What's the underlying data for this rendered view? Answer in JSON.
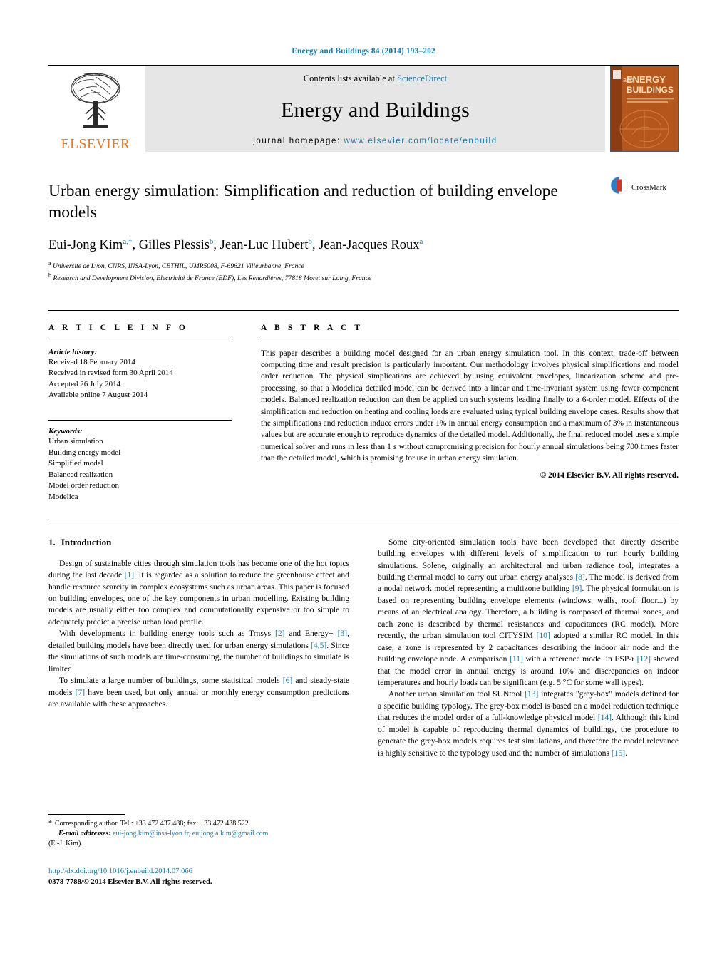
{
  "running_head": "Energy and Buildings 84 (2014) 193–202",
  "masthead": {
    "contents_prefix": "Contents lists available at ",
    "contents_link": "ScienceDirect",
    "journal_name": "Energy and Buildings",
    "homepage_prefix": "journal homepage: ",
    "homepage_url": "www.elsevier.com/locate/enbuild",
    "publisher": "ELSEVIER",
    "cover_title_small": "and",
    "cover_title_main": "ENERGY",
    "cover_title_main2": "BUILDINGS"
  },
  "article": {
    "title": "Urban energy simulation: Simplification and reduction of building envelope models",
    "authors_html": "Eui-Jong Kim, Gilles Plessis, Jean-Luc Hubert, Jean-Jacques Roux",
    "author_list": [
      {
        "name": "Eui-Jong Kim",
        "marks": "a,*"
      },
      {
        "name": "Gilles Plessis",
        "marks": "b"
      },
      {
        "name": "Jean-Luc Hubert",
        "marks": "b"
      },
      {
        "name": "Jean-Jacques Roux",
        "marks": "a"
      }
    ],
    "affiliations": [
      {
        "mark": "a",
        "text": "Université de Lyon, CNRS, INSA-Lyon, CETHIL, UMR5008, F-69621 Villeurbanne, France"
      },
      {
        "mark": "b",
        "text": "Research and Development Division, Electricité de France (EDF), Les Renardières, 77818 Moret sur Loing, France"
      }
    ],
    "crossmark_label": "CrossMark"
  },
  "article_info": {
    "heading": "A R T I C L E   I N F O",
    "history_label": "Article history:",
    "history": [
      "Received 18 February 2014",
      "Received in revised form 30 April 2014",
      "Accepted 26 July 2014",
      "Available online 7 August 2014"
    ],
    "keywords_label": "Keywords:",
    "keywords": [
      "Urban simulation",
      "Building energy model",
      "Simplified model",
      "Balanced realization",
      "Model order reduction",
      "Modelica"
    ]
  },
  "abstract": {
    "heading": "A B S T R A C T",
    "text": "This paper describes a building model designed for an urban energy simulation tool. In this context, trade-off between computing time and result precision is particularly important. Our methodology involves physical simplifications and model order reduction. The physical simplications are achieved by using equivalent envelopes, linearization scheme and pre-processing, so that a Modelica detailed model can be derived into a linear and time-invariant system using fewer component models. Balanced realization reduction can then be applied on such systems leading finally to a 6-order model. Effects of the simplification and reduction on heating and cooling loads are evaluated using typical building envelope cases. Results show that the simplifications and reduction induce errors under 1% in annual energy consumption and a maximum of 3% in instantaneous values but are accurate enough to reproduce dynamics of the detailed model. Additionally, the final reduced model uses a simple numerical solver and runs in less than 1 s without compromising precision for hourly annual simulations being 700 times faster than the detailed model, which is promising for use in urban energy simulation.",
    "copyright": "© 2014 Elsevier B.V. All rights reserved."
  },
  "introduction": {
    "number": "1.",
    "heading": "Introduction",
    "left_paragraphs": [
      {
        "parts": [
          {
            "t": "Design of sustainable cities through simulation tools has become one of the hot topics during the last decade ",
            "k": "text"
          },
          {
            "t": "[1]",
            "k": "cite"
          },
          {
            "t": ". It is regarded as a solution to reduce the greenhouse effect and handle resource scarcity in complex ecosystems such as urban areas. This paper is focused on building envelopes, one of the key components in urban modelling. Existing building models are usually either too complex and computationally expensive or too simple to adequately predict a precise urban load profile.",
            "k": "text"
          }
        ]
      },
      {
        "parts": [
          {
            "t": "With developments in building energy tools such as Trnsys ",
            "k": "text"
          },
          {
            "t": "[2]",
            "k": "cite"
          },
          {
            "t": " and Energy+ ",
            "k": "text"
          },
          {
            "t": "[3]",
            "k": "cite"
          },
          {
            "t": ", detailed building models have been directly used for urban energy simulations ",
            "k": "text"
          },
          {
            "t": "[4,5]",
            "k": "cite"
          },
          {
            "t": ". Since the simulations of such models are time-consuming, the number of buildings to simulate is limited.",
            "k": "text"
          }
        ]
      },
      {
        "parts": [
          {
            "t": "To simulate a large number of buildings, some statistical models ",
            "k": "text"
          },
          {
            "t": "[6]",
            "k": "cite"
          },
          {
            "t": " and steady-state models ",
            "k": "text"
          },
          {
            "t": "[7]",
            "k": "cite"
          },
          {
            "t": " have been used, but only annual or monthly energy consumption predictions are available with these approaches.",
            "k": "text"
          }
        ]
      }
    ],
    "right_paragraphs": [
      {
        "parts": [
          {
            "t": "Some city-oriented simulation tools have been developed that directly describe building envelopes with different levels of simplification to run hourly building simulations. Solene, originally an architectural and urban radiance tool, integrates a building thermal model to carry out urban energy analyses ",
            "k": "text"
          },
          {
            "t": "[8]",
            "k": "cite"
          },
          {
            "t": ". The model is derived from a nodal network model representing a multizone building ",
            "k": "text"
          },
          {
            "t": "[9]",
            "k": "cite"
          },
          {
            "t": ". The physical formulation is based on representing building envelope elements (windows, walls, roof, floor...) by means of an electrical analogy. Therefore, a building is composed of thermal zones, and each zone is described by thermal resistances and capacitances (RC model). More recently, the urban simulation tool CITYSIM ",
            "k": "text"
          },
          {
            "t": "[10]",
            "k": "cite"
          },
          {
            "t": " adopted a similar RC model. In this case, a zone is represented by 2 capacitances describing the indoor air node and the building envelope node. A comparison ",
            "k": "text"
          },
          {
            "t": "[11]",
            "k": "cite"
          },
          {
            "t": " with a reference model in ESP-r ",
            "k": "text"
          },
          {
            "t": "[12]",
            "k": "cite"
          },
          {
            "t": " showed that the model error in annual energy is around 10% and discrepancies on indoor temperatures and hourly loads can be significant (e.g. 5 °C for some wall types).",
            "k": "text"
          }
        ]
      },
      {
        "parts": [
          {
            "t": "Another urban simulation tool SUNtool ",
            "k": "text"
          },
          {
            "t": "[13]",
            "k": "cite"
          },
          {
            "t": " integrates \"grey-box\" models defined for a specific building typology. The grey-box model is based on a model reduction technique that reduces the model order of a full-knowledge physical model ",
            "k": "text"
          },
          {
            "t": "[14]",
            "k": "cite"
          },
          {
            "t": ". Although this kind of model is capable of reproducing thermal dynamics of buildings, the procedure to generate the grey-box models requires test simulations, and therefore the model relevance is highly sensitive to the typology used and the number of simulations ",
            "k": "text"
          },
          {
            "t": "[15]",
            "k": "cite"
          },
          {
            "t": ".",
            "k": "text"
          }
        ]
      }
    ]
  },
  "footnotes": {
    "corresponding_star": "*",
    "corresponding": "Corresponding author. Tel.: +33 472 437 488; fax: +33 472 438 522.",
    "email_label": "E-mail addresses:",
    "email_1": "eui-jong.kim@insa-lyon.fr",
    "email_sep": ", ",
    "email_2": "euijong.a.kim@gmail.com",
    "email_suffix": "(E.-J. Kim).",
    "doi": "http://dx.doi.org/10.1016/j.enbuild.2014.07.066",
    "issn": "0378-7788/© 2014 Elsevier B.V. All rights reserved."
  },
  "colors": {
    "link": "#1b7aa6",
    "elsevier_orange": "#e87722",
    "band_grey": "#e6e6e6",
    "cover_orange": "#b5561c"
  }
}
